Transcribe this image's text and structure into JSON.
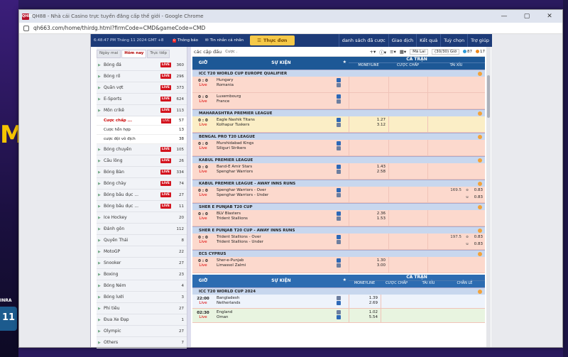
{
  "browser": {
    "favicon": "QH88",
    "title": "QH88 - Nhà cái Casino trực tuyến đẳng cấp thế giới - Google Chrome",
    "url": "qh663.com/home/thirdg.html?firmCode=CMD&gameCode=CMD",
    "controls": [
      "—",
      "▢",
      "✕"
    ]
  },
  "background": {
    "logo_fragment": "M",
    "inra": "INRA",
    "number": "11"
  },
  "topbar": {
    "clock": "6:48:47 PM Tháng 11 2024 GMT +8",
    "notice": "Thông báo",
    "notice_badge": "0",
    "inbox": "Tin nhắn cá nhân",
    "menu": "Thực đơn",
    "tabs": [
      "danh sách đã cược",
      "Giao dịch",
      "Kết quả",
      "Tuỳ chọn",
      "Trợ giúp"
    ]
  },
  "sidebar": {
    "header": "ĐĂ THỂ THAO",
    "tabs": [
      {
        "label": "Ngày mai",
        "active": false
      },
      {
        "label": "Hôm nay",
        "active": true
      },
      {
        "label": "Trực tiếp",
        "active": false
      }
    ],
    "items": [
      {
        "label": "Bóng đá",
        "live": true,
        "count": "360"
      },
      {
        "label": "Bóng rổ",
        "live": true,
        "count": "296"
      },
      {
        "label": "Quần vợt",
        "live": true,
        "count": "373"
      },
      {
        "label": "E-Sports",
        "live": true,
        "count": "624"
      },
      {
        "label": "Môn crikê",
        "live": true,
        "count": "113"
      }
    ],
    "sub_items": [
      {
        "label": "Cược chấp ...",
        "live": true,
        "count": "57",
        "active": true
      },
      {
        "label": "Cược hỗn hợp",
        "live": false,
        "count": "13",
        "active": false
      },
      {
        "label": "cược đội vô địch",
        "live": false,
        "count": "38",
        "active": false
      }
    ],
    "items_after": [
      {
        "label": "Bóng chuyền",
        "live": true,
        "count": "105"
      },
      {
        "label": "Cầu lông",
        "live": true,
        "count": "26"
      },
      {
        "label": "Bóng Bàn",
        "live": true,
        "count": "334"
      },
      {
        "label": "Bóng chày",
        "live": true,
        "count": "74"
      },
      {
        "label": "Bóng bầu dục ...",
        "live": true,
        "count": "27"
      },
      {
        "label": "Bóng bầu dục ...",
        "live": true,
        "count": "11"
      },
      {
        "label": "Ice Hockey",
        "live": false,
        "count": "20"
      },
      {
        "label": "Đánh gôn",
        "live": false,
        "count": "112"
      },
      {
        "label": "Quyền Thái",
        "live": false,
        "count": "8"
      },
      {
        "label": "MotoGP",
        "live": false,
        "count": "22"
      },
      {
        "label": "Snooker",
        "live": false,
        "count": "27"
      },
      {
        "label": "Boxing",
        "live": false,
        "count": "23"
      },
      {
        "label": "Bóng Ném",
        "live": false,
        "count": "4"
      },
      {
        "label": "Bóng lưới",
        "live": false,
        "count": "3"
      },
      {
        "label": "Phi tiêu",
        "live": false,
        "count": "27"
      },
      {
        "label": "Đua Xe Đạp",
        "live": false,
        "count": "1"
      },
      {
        "label": "Olympic",
        "live": false,
        "count": "27"
      },
      {
        "label": "Others",
        "live": false,
        "count": "7"
      }
    ]
  },
  "filters": {
    "match_type": "các cặp đấu",
    "bet_type": "Cược .",
    "odds_type": "Mã Lai",
    "period": "(30/30) Giờ",
    "chip1": "87",
    "chip2": "17"
  },
  "table_head": {
    "time": "GIỜ",
    "event": "SỰ KIỆN",
    "full_time": "CẢ TRẬN",
    "moneyline": "MONEYLINE",
    "handicap": "CƯỢC CHẤP",
    "over_under": "TÀI XỈU"
  },
  "leagues": [
    {
      "name": "ICC T20 WORLD CUP EUROPE QUALIFIER",
      "matches": [
        {
          "score": "0 : 0",
          "status": "Live",
          "home": "Hungary",
          "away": "Romania",
          "ml_home": "",
          "ml_away": "",
          "ou_line": "",
          "ou_o": "",
          "ou_u": "",
          "kind": "live"
        },
        {
          "score": "0 : 0",
          "status": "Live",
          "home": "Luxembourg",
          "away": "France",
          "ml_home": "",
          "ml_away": "",
          "ou_line": "",
          "ou_o": "",
          "ou_u": "",
          "kind": "live"
        }
      ]
    },
    {
      "name": "MAHARASHTRA PREMIER LEAGUE",
      "matches": [
        {
          "score": "0 : 0",
          "status": "Live",
          "home": "Eagle Nashik Titans",
          "away": "Kolhapur Tuskers",
          "ml_home": "1.27",
          "ml_away": "3.12",
          "ou_line": "",
          "ou_o": "",
          "ou_u": "",
          "kind": "pre"
        }
      ]
    },
    {
      "name": "BENGAL PRO T20 LEAGUE",
      "matches": [
        {
          "score": "0 : 0",
          "status": "Live",
          "home": "Murshidabad Kings",
          "away": "Siliguri Strikers",
          "ml_home": "",
          "ml_away": "",
          "ou_line": "",
          "ou_o": "",
          "ou_u": "",
          "kind": "live"
        }
      ]
    },
    {
      "name": "KABUL PREMIER LEAGUE",
      "matches": [
        {
          "score": "0 : 0",
          "status": "Live",
          "home": "Band-E Amir Stars",
          "away": "Spenghar Warriors",
          "ml_home": "1.43",
          "ml_away": "2.58",
          "ou_line": "",
          "ou_o": "",
          "ou_u": "",
          "kind": "live"
        }
      ]
    },
    {
      "name": "KABUL PREMIER LEAGUE - AWAY INNS RUNS",
      "matches": [
        {
          "score": "0 : 0",
          "status": "Live",
          "home": "Spenghar Warriors - Over",
          "away": "Spenghar Warriors - Under",
          "ml_home": "",
          "ml_away": "",
          "ou_line": "169.5",
          "ou_o": "0.83",
          "ou_u": "0.83",
          "kind": "live"
        }
      ]
    },
    {
      "name": "SHER E PUNJAB T20 CUP",
      "matches": [
        {
          "score": "0 : 0",
          "status": "Live",
          "home": "BLV Blasters",
          "away": "Trident Stallions",
          "ml_home": "2.36",
          "ml_away": "1.53",
          "ou_line": "",
          "ou_o": "",
          "ou_u": "",
          "kind": "live"
        }
      ]
    },
    {
      "name": "SHER E PUNJAB T20 CUP - AWAY INNS RUNS",
      "matches": [
        {
          "score": "0 : 0",
          "status": "Live",
          "home": "Trident Stallions - Over",
          "away": "Trident Stallions - Under",
          "ml_home": "",
          "ml_away": "",
          "ou_line": "197.5",
          "ou_o": "0.83",
          "ou_u": "0.83",
          "kind": "live"
        }
      ]
    },
    {
      "name": "ECS CYPRUS",
      "matches": [
        {
          "score": "0 : 0",
          "status": "Live",
          "home": "Sher-e-Punjab",
          "away": "Limassol Zalmi",
          "ml_home": "1.30",
          "ml_away": "3.00",
          "ou_line": "",
          "ou_o": "",
          "ou_u": "",
          "kind": "live"
        }
      ]
    }
  ],
  "table2_head": {
    "time": "GIỜ",
    "event": "SỰ KIỆN",
    "full_time": "CẢ TRẬN",
    "moneyline": "MONEYLINE",
    "handicap": "CƯỢC CHẤP",
    "over_under": "TÀI XỈU",
    "odd_even": "CHẴN LẺ"
  },
  "leagues2": [
    {
      "name": "ICC T20 WORLD CUP 2024",
      "matches": [
        {
          "time": "22:00",
          "status": "Live",
          "home": "Bangladesh",
          "away": "Netherlands",
          "ml_home": "1.39",
          "ml_away": "2.69"
        },
        {
          "time": "02:30",
          "status": "Live",
          "home": "England",
          "away": "Oman",
          "ml_home": "1.02",
          "ml_away": "5.54"
        }
      ]
    }
  ],
  "colors": {
    "accent": "#1d3b78",
    "live_row": "#fcd9cd",
    "pre_row": "#fbeec6",
    "live_badge": "#d3131e",
    "league_bg": "#c8d7ee"
  }
}
